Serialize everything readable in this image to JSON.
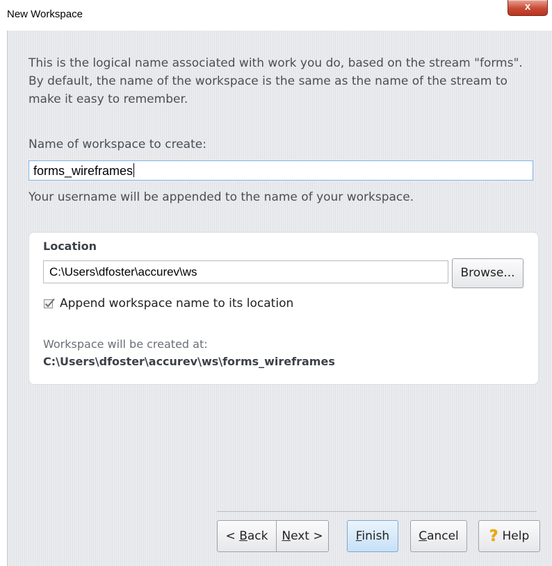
{
  "window": {
    "title": "New Workspace",
    "close_label": "x"
  },
  "intro": {
    "text": "This is the logical name associated with work you do, based on the stream \"forms\". By default, the name of the workspace is the same as the name of the stream to make it easy to remember."
  },
  "name_field": {
    "label": "Name of workspace to create:",
    "value": "forms_wireframes",
    "hint": "Your username will be appended to the name of your workspace."
  },
  "location": {
    "title": "Location",
    "path_value": "C:\\Users\\dfoster\\accurev\\ws",
    "browse_label": "Browse...",
    "append_checkbox_label": "Append workspace name to its location",
    "append_checked": true,
    "will_be_created_label": "Workspace will be created at:",
    "full_path": "C:\\Users\\dfoster\\accurev\\ws\\forms_wireframes"
  },
  "buttons": {
    "back_prefix": "< ",
    "back_mnemonic": "B",
    "back_rest": "ack",
    "next_mnemonic": "N",
    "next_rest": "ext >",
    "finish_mnemonic": "F",
    "finish_rest": "inish",
    "cancel_mnemonic": "C",
    "cancel_rest": "ancel",
    "help_label": "Help"
  }
}
